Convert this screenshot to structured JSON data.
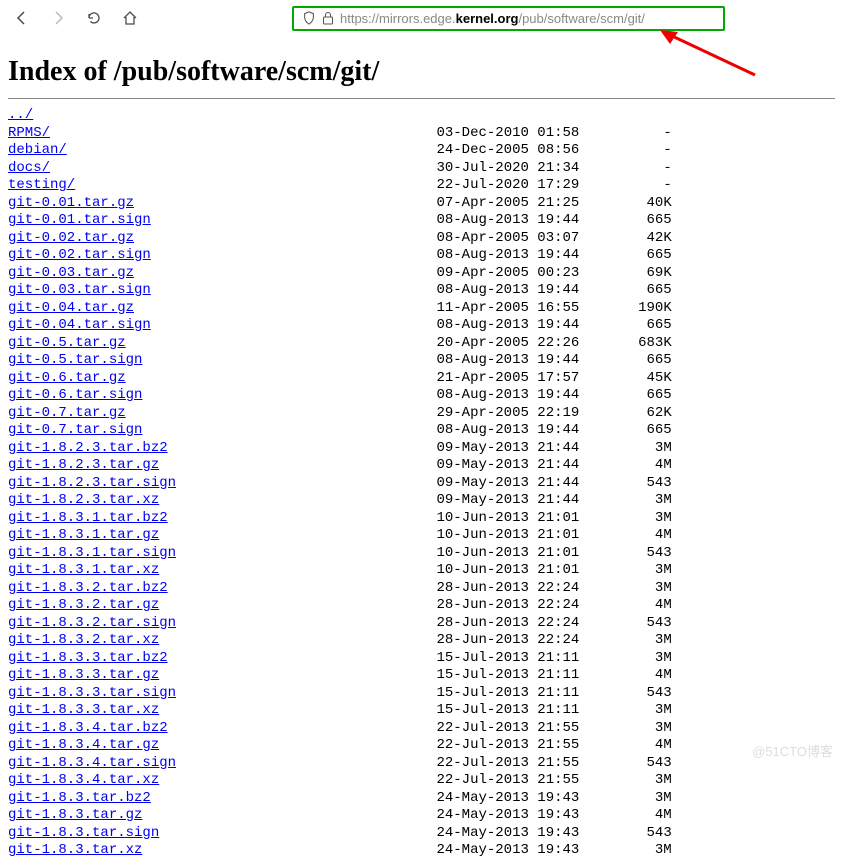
{
  "toolbar": {
    "url_prefix": "https://mirrors.edge.",
    "url_bold": "kernel.org",
    "url_suffix": "/pub/software/scm/git/"
  },
  "page": {
    "title": "Index of /pub/software/scm/git/",
    "parent": "../"
  },
  "listing": [
    {
      "name": "RPMS/",
      "date": "03-Dec-2010 01:58",
      "size": "-"
    },
    {
      "name": "debian/",
      "date": "24-Dec-2005 08:56",
      "size": "-"
    },
    {
      "name": "docs/",
      "date": "30-Jul-2020 21:34",
      "size": "-"
    },
    {
      "name": "testing/",
      "date": "22-Jul-2020 17:29",
      "size": "-"
    },
    {
      "name": "git-0.01.tar.gz",
      "date": "07-Apr-2005 21:25",
      "size": "40K"
    },
    {
      "name": "git-0.01.tar.sign",
      "date": "08-Aug-2013 19:44",
      "size": "665"
    },
    {
      "name": "git-0.02.tar.gz",
      "date": "08-Apr-2005 03:07",
      "size": "42K"
    },
    {
      "name": "git-0.02.tar.sign",
      "date": "08-Aug-2013 19:44",
      "size": "665"
    },
    {
      "name": "git-0.03.tar.gz",
      "date": "09-Apr-2005 00:23",
      "size": "69K"
    },
    {
      "name": "git-0.03.tar.sign",
      "date": "08-Aug-2013 19:44",
      "size": "665"
    },
    {
      "name": "git-0.04.tar.gz",
      "date": "11-Apr-2005 16:55",
      "size": "190K"
    },
    {
      "name": "git-0.04.tar.sign",
      "date": "08-Aug-2013 19:44",
      "size": "665"
    },
    {
      "name": "git-0.5.tar.gz",
      "date": "20-Apr-2005 22:26",
      "size": "683K"
    },
    {
      "name": "git-0.5.tar.sign",
      "date": "08-Aug-2013 19:44",
      "size": "665"
    },
    {
      "name": "git-0.6.tar.gz",
      "date": "21-Apr-2005 17:57",
      "size": "45K"
    },
    {
      "name": "git-0.6.tar.sign",
      "date": "08-Aug-2013 19:44",
      "size": "665"
    },
    {
      "name": "git-0.7.tar.gz",
      "date": "29-Apr-2005 22:19",
      "size": "62K"
    },
    {
      "name": "git-0.7.tar.sign",
      "date": "08-Aug-2013 19:44",
      "size": "665"
    },
    {
      "name": "git-1.8.2.3.tar.bz2",
      "date": "09-May-2013 21:44",
      "size": "3M"
    },
    {
      "name": "git-1.8.2.3.tar.gz",
      "date": "09-May-2013 21:44",
      "size": "4M"
    },
    {
      "name": "git-1.8.2.3.tar.sign",
      "date": "09-May-2013 21:44",
      "size": "543"
    },
    {
      "name": "git-1.8.2.3.tar.xz",
      "date": "09-May-2013 21:44",
      "size": "3M"
    },
    {
      "name": "git-1.8.3.1.tar.bz2",
      "date": "10-Jun-2013 21:01",
      "size": "3M"
    },
    {
      "name": "git-1.8.3.1.tar.gz",
      "date": "10-Jun-2013 21:01",
      "size": "4M"
    },
    {
      "name": "git-1.8.3.1.tar.sign",
      "date": "10-Jun-2013 21:01",
      "size": "543"
    },
    {
      "name": "git-1.8.3.1.tar.xz",
      "date": "10-Jun-2013 21:01",
      "size": "3M"
    },
    {
      "name": "git-1.8.3.2.tar.bz2",
      "date": "28-Jun-2013 22:24",
      "size": "3M"
    },
    {
      "name": "git-1.8.3.2.tar.gz",
      "date": "28-Jun-2013 22:24",
      "size": "4M"
    },
    {
      "name": "git-1.8.3.2.tar.sign",
      "date": "28-Jun-2013 22:24",
      "size": "543"
    },
    {
      "name": "git-1.8.3.2.tar.xz",
      "date": "28-Jun-2013 22:24",
      "size": "3M"
    },
    {
      "name": "git-1.8.3.3.tar.bz2",
      "date": "15-Jul-2013 21:11",
      "size": "3M"
    },
    {
      "name": "git-1.8.3.3.tar.gz",
      "date": "15-Jul-2013 21:11",
      "size": "4M"
    },
    {
      "name": "git-1.8.3.3.tar.sign",
      "date": "15-Jul-2013 21:11",
      "size": "543"
    },
    {
      "name": "git-1.8.3.3.tar.xz",
      "date": "15-Jul-2013 21:11",
      "size": "3M"
    },
    {
      "name": "git-1.8.3.4.tar.bz2",
      "date": "22-Jul-2013 21:55",
      "size": "3M"
    },
    {
      "name": "git-1.8.3.4.tar.gz",
      "date": "22-Jul-2013 21:55",
      "size": "4M"
    },
    {
      "name": "git-1.8.3.4.tar.sign",
      "date": "22-Jul-2013 21:55",
      "size": "543"
    },
    {
      "name": "git-1.8.3.4.tar.xz",
      "date": "22-Jul-2013 21:55",
      "size": "3M"
    },
    {
      "name": "git-1.8.3.tar.bz2",
      "date": "24-May-2013 19:43",
      "size": "3M"
    },
    {
      "name": "git-1.8.3.tar.gz",
      "date": "24-May-2013 19:43",
      "size": "4M"
    },
    {
      "name": "git-1.8.3.tar.sign",
      "date": "24-May-2013 19:43",
      "size": "543"
    },
    {
      "name": "git-1.8.3.tar.xz",
      "date": "24-May-2013 19:43",
      "size": "3M"
    }
  ],
  "watermark": "@51CTO博客"
}
